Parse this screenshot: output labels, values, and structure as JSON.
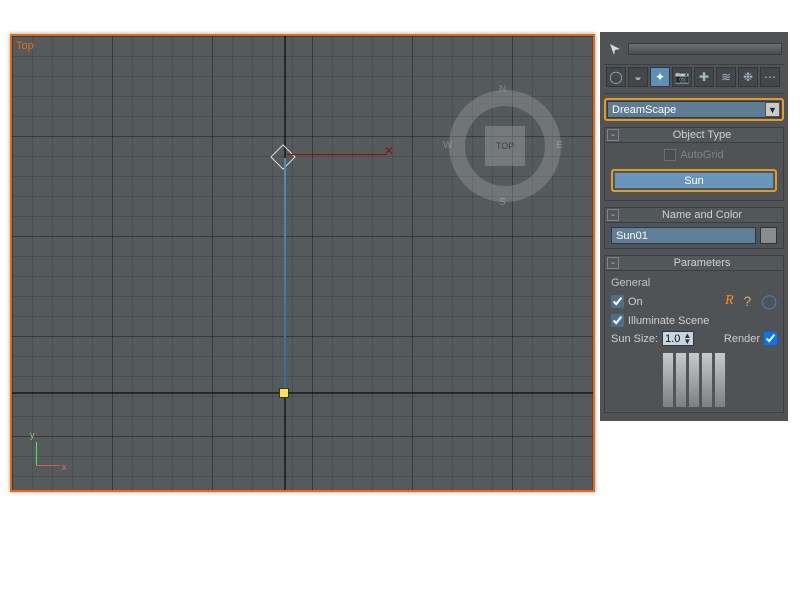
{
  "viewport": {
    "label": "Top",
    "compass_face": "TOP",
    "compass_dirs": {
      "n": "N",
      "e": "E",
      "s": "S",
      "w": "W"
    },
    "axes": {
      "x": "x",
      "y": "y"
    }
  },
  "panel": {
    "category_dropdown": "DreamScape",
    "rollups": {
      "object_type": {
        "title": "Object Type",
        "autogrid_label": "AutoGrid",
        "button_label": "Sun"
      },
      "name_and_color": {
        "title": "Name and Color",
        "value": "Sun01"
      },
      "parameters": {
        "title": "Parameters",
        "group": "General",
        "on_label": "On",
        "on_checked": true,
        "illuminate_label": "Illuminate Scene",
        "illuminate_checked": true,
        "sunsize_label": "Sun Size:",
        "sunsize_value": "1.0",
        "render_label": "Render",
        "render_checked": true
      }
    },
    "shelf_icons": [
      "sphere-icon",
      "pick-icon",
      "light-icon",
      "camera-icon",
      "helper-icon",
      "space-icon",
      "wave-icon",
      "systems-icon"
    ],
    "help_icons": {
      "r": "R",
      "q": "?",
      "o": "◯"
    }
  }
}
